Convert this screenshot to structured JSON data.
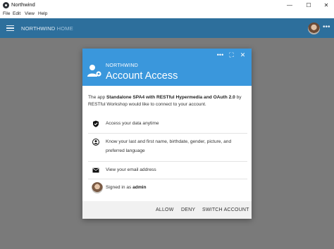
{
  "window": {
    "title": "Northwind",
    "controls": {
      "minimize": "—",
      "maximize": "☐",
      "close": "✕"
    }
  },
  "menu": {
    "items": [
      "File",
      "Edit",
      "View",
      "Help"
    ]
  },
  "appbar": {
    "brand": "NORTHWIND",
    "section": "HOME",
    "more": "•••"
  },
  "dialog": {
    "brand": "NORTHWIND",
    "title": "Account Access",
    "header_more": "•••",
    "header_expand": "⛶",
    "header_close": "✕",
    "description": {
      "pre": "The app ",
      "app": "Standalone SPA4 with RESTful Hypermedia and OAuth 2.0",
      "mid": " by ",
      "publisher": "RESTful Workshop",
      "post": " would like to connect to your account."
    },
    "permissions": [
      {
        "icon": "shield-icon",
        "text": "Access your data anytime"
      },
      {
        "icon": "person-icon",
        "text": "Know your last and first name, birthdate, gender, picture, and preferred language"
      },
      {
        "icon": "envelope-icon",
        "text": "View your email address"
      }
    ],
    "signed_in_label": "Signed in as ",
    "signed_in_user": "admin",
    "actions": {
      "allow": "ALLOW",
      "deny": "DENY",
      "switch": "SWITCH ACCOUNT"
    }
  },
  "colors": {
    "appbar": "#2d6f9c",
    "dialog_header": "#3a97dc",
    "backdrop": "#7a7a7a",
    "footer": "#f1f1f1"
  }
}
